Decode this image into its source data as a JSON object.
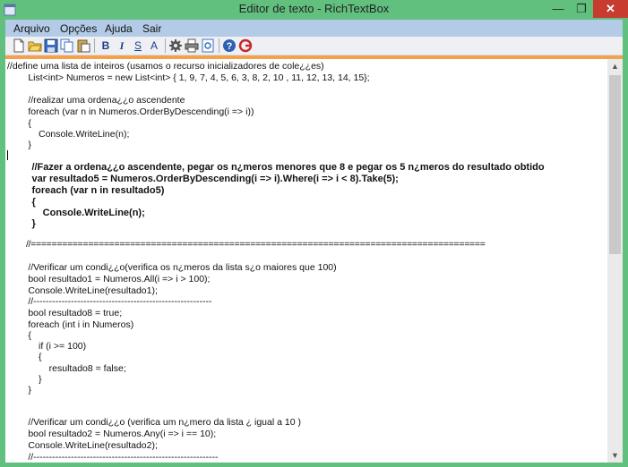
{
  "window": {
    "title": "Editor de texto  - RichTextBox",
    "min_glyph": "—",
    "max_glyph": "❐",
    "close_glyph": "✕"
  },
  "menu": {
    "items": [
      "Arquivo",
      "Opções",
      "Ajuda",
      "Sair"
    ]
  },
  "toolbar": {
    "bold_label": "B",
    "italic_label": "I",
    "strike_label": "S",
    "fontsize_label": "A"
  },
  "editor": {
    "lines": [
      "//define uma lista de inteiros (usamos o recurso inicializadores de cole¿¿es)",
      "        List<int> Numeros = new List<int> { 1, 9, 7, 4, 5, 6, 3, 8, 2, 10 , 11, 12, 13, 14, 15};",
      "",
      "        //realizar uma ordena¿¿o ascendente",
      "        foreach (var n in Numeros.OrderByDescending(i => i))",
      "        {",
      "            Console.WriteLine(n);",
      "        }",
      "",
      "        //Fazer a ordena¿¿o ascendente, pegar os n¿meros menores que 8 e pegar os 5 n¿meros do resultado obtido",
      "        var resultado5 = Numeros.OrderByDescending(i => i).Where(i => i < 8).Take(5);",
      "        foreach (var n in resultado5)",
      "        {",
      "            Console.WriteLine(n);",
      "        }",
      "",
      "        //=======================================================================================",
      "",
      "        //Verificar um condi¿¿o(verifica os n¿meros da lista s¿o maiores que 100)",
      "        bool resultado1 = Numeros.All(i => i > 100);",
      "        Console.WriteLine(resultado1);",
      "        //---------------------------------------------------------",
      "        bool resultado8 = true;",
      "        foreach (int i in Numeros)",
      "        {",
      "            if (i >= 100)",
      "            {",
      "                resultado8 = false;",
      "            }",
      "        }",
      "",
      "",
      "        //Verificar um condi¿¿o (verifica um n¿mero da lista ¿ igual a 10 )",
      "        bool resultado2 = Numeros.Any(i => i == 10);",
      "        Console.WriteLine(resultado2);",
      "        //-----------------------------------------------------------"
    ]
  },
  "colors": {
    "frame": "#62c07f",
    "menubar": "#b3cbe6",
    "accent": "#f6a04a",
    "close": "#c73c2f"
  }
}
